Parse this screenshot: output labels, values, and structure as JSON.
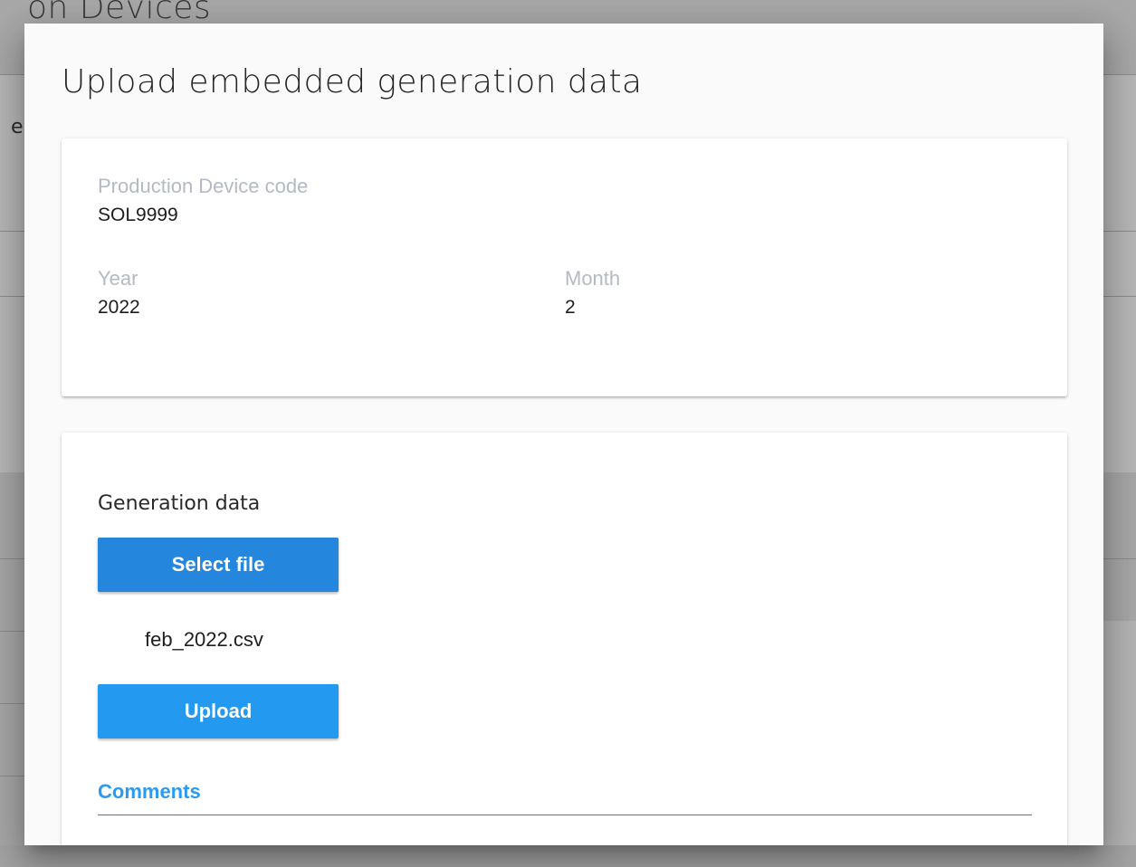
{
  "background": {
    "page_title": "on Devices",
    "fragment": "e"
  },
  "modal": {
    "title": "Upload embedded generation data",
    "info": {
      "device_code_label": "Production Device code",
      "device_code_value": "SOL9999",
      "year_label": "Year",
      "year_value": "2022",
      "month_label": "Month",
      "month_value": "2"
    },
    "generation": {
      "section_title": "Generation data",
      "select_file_label": "Select file",
      "selected_file": "feb_2022.csv",
      "upload_label": "Upload",
      "comments_label": "Comments",
      "comments_value": ""
    }
  },
  "colors": {
    "select_button": "#2486dc",
    "upload_button": "#2399f0",
    "accent": "#2a9af2"
  }
}
